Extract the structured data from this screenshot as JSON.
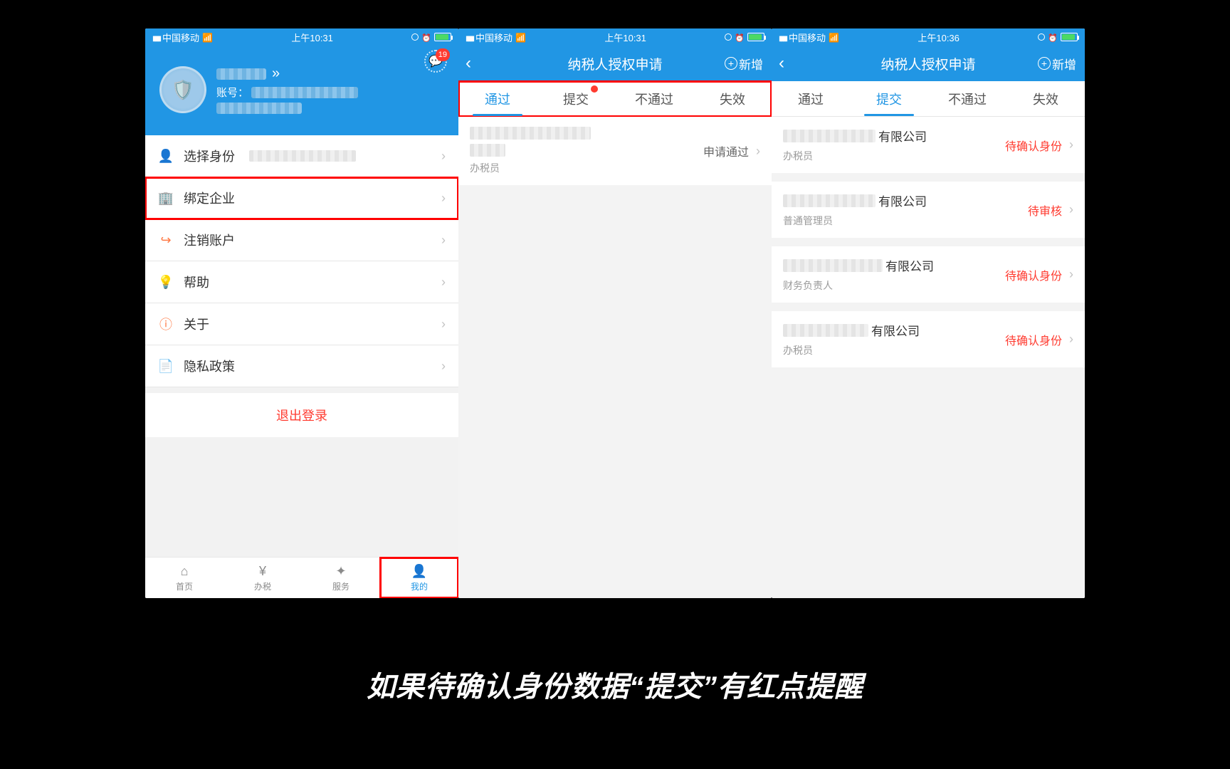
{
  "caption": "如果待确认身份数据“提交”有红点提醒",
  "status_bar": {
    "carrier": "中国移动",
    "time1": "上午10:31",
    "time2": "上午10:31",
    "time3": "上午10:36"
  },
  "screen1": {
    "badge_count": "19",
    "account_label": "账号：",
    "name_chevron": "»",
    "menu": [
      {
        "icon": "user",
        "label": "选择身份"
      },
      {
        "icon": "build",
        "label": "绑定企业"
      },
      {
        "icon": "logout",
        "label": "注销账户"
      },
      {
        "icon": "help",
        "label": "帮助"
      },
      {
        "icon": "about",
        "label": "关于"
      },
      {
        "icon": "priv",
        "label": "隐私政策"
      }
    ],
    "logout": "退出登录",
    "tabs": [
      {
        "label": "首页"
      },
      {
        "label": "办税"
      },
      {
        "label": "服务"
      },
      {
        "label": "我的"
      }
    ]
  },
  "screen2": {
    "title": "纳税人授权申请",
    "add": "新增",
    "seg_tabs": [
      "通过",
      "提交",
      "不通过",
      "失效"
    ],
    "card": {
      "role": "办税员",
      "status": "申请通过"
    }
  },
  "screen3": {
    "title": "纳税人授权申请",
    "add": "新增",
    "seg_tabs": [
      "通过",
      "提交",
      "不通过",
      "失效"
    ],
    "cards": [
      {
        "suffix": "有限公司",
        "role": "办税员",
        "status": "待确认身份"
      },
      {
        "suffix": "有限公司",
        "role": "普通管理员",
        "status": "待审核"
      },
      {
        "suffix": "有限公司",
        "role": "财务负责人",
        "status": "待确认身份"
      },
      {
        "suffix": "有限公司",
        "role": "办税员",
        "status": "待确认身份"
      }
    ]
  }
}
